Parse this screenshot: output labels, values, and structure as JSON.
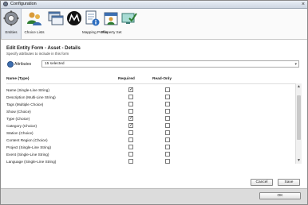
{
  "window": {
    "title": "Configuration",
    "close_glyph": "×"
  },
  "toolbar": {
    "items": [
      {
        "label": "Entities",
        "icon": "gear-icon"
      },
      {
        "label": "Choice Lists",
        "icon": "users-icon"
      },
      {
        "label": "Mapping Profile",
        "icon": "windows-icon"
      },
      {
        "label": "Property Set",
        "icon": "logo-icon"
      }
    ]
  },
  "form": {
    "heading": "Edit Entity Form - Asset - Details",
    "subheading": "Specify attributes to include in this form",
    "attributes_label": "Attributes",
    "attributes_value": "15 selected",
    "col_name": "Name (Type)",
    "col_required": "Required",
    "col_readonly": "Read-Only",
    "rows": [
      {
        "name": "Name (Single-Line String)",
        "required": true,
        "readonly": false
      },
      {
        "name": "Description (Multi-Line String)",
        "required": false,
        "readonly": false
      },
      {
        "name": "Tags (Multiple Choice)",
        "required": false,
        "readonly": false
      },
      {
        "name": "Show (Choice)",
        "required": false,
        "readonly": false
      },
      {
        "name": "Type (Choice)",
        "required": true,
        "readonly": false
      },
      {
        "name": "Category (Choice)",
        "required": true,
        "readonly": false
      },
      {
        "name": "Station (Choice)",
        "required": false,
        "readonly": false
      },
      {
        "name": "Content Region (Choice)",
        "required": false,
        "readonly": false
      },
      {
        "name": "Project (Single-Line String)",
        "required": false,
        "readonly": false
      },
      {
        "name": "Event (Single-Line String)",
        "required": false,
        "readonly": false
      },
      {
        "name": "Language (Single-Line String)",
        "required": false,
        "readonly": false
      }
    ]
  },
  "buttons": {
    "cancel": "Cancel",
    "save": "Save",
    "ok": "OK"
  }
}
